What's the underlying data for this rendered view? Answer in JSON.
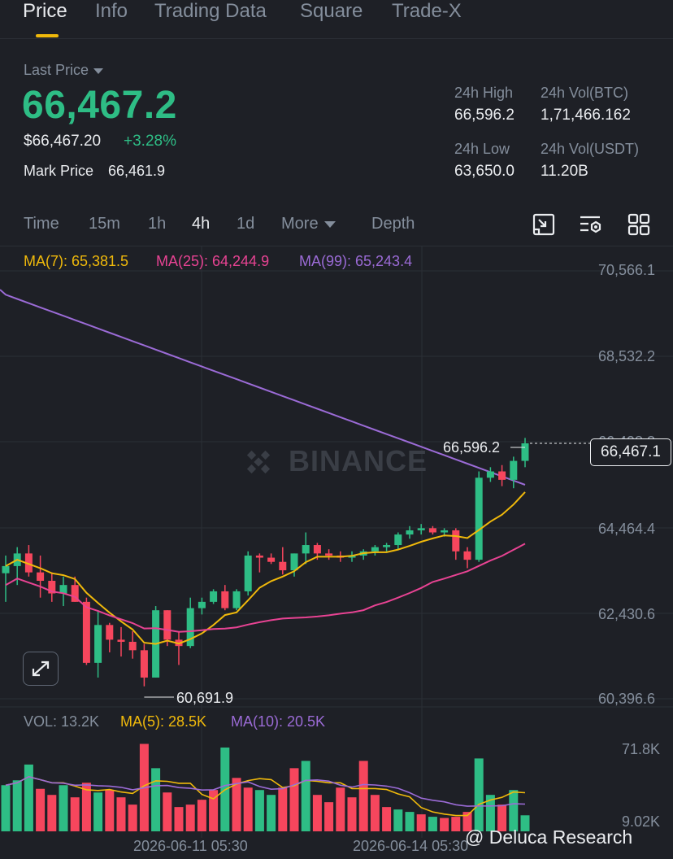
{
  "tabs": [
    {
      "label": "Price",
      "active": true
    },
    {
      "label": "Info",
      "active": false
    },
    {
      "label": "Trading Data",
      "active": false
    },
    {
      "label": "Square",
      "active": false
    },
    {
      "label": "Trade-X",
      "active": false
    }
  ],
  "header": {
    "last_price_label": "Last Price",
    "last_price": "66,467.2",
    "usd_price": "$66,467.20",
    "change_pct": "+3.28%",
    "mark_price_label": "Mark Price",
    "mark_price": "66,461.9"
  },
  "stats": {
    "high_label": "24h High",
    "high_value": "66,596.2",
    "vol_btc_label": "24h Vol(BTC)",
    "vol_btc_value": "1,71,466.162",
    "low_label": "24h Low",
    "low_value": "63,650.0",
    "vol_usdt_label": "24h Vol(USDT)",
    "vol_usdt_value": "11.20B"
  },
  "intervals": {
    "time": "Time",
    "i15m": "15m",
    "i1h": "1h",
    "i4h": "4h",
    "i1d": "1d",
    "more": "More",
    "depth": "Depth",
    "active": "4h"
  },
  "toolbar_icons": [
    "fullscreen-icon",
    "indicator-settings-icon",
    "layout-grid-icon"
  ],
  "ma_legend": {
    "ma7": "MA(7): 65,381.5",
    "ma25": "MA(25): 64,244.9",
    "ma99": "MA(99): 65,243.4"
  },
  "price_axis": [
    "70,566.1",
    "68,532.2",
    "66,498.3",
    "64,464.4",
    "62,430.6",
    "60,396.6"
  ],
  "current_price_tag": "66,467.1",
  "high_marker": "66,596.2",
  "low_marker": "60,691.9",
  "watermark": "BINANCE",
  "volume_legend": {
    "vol": "VOL: 13.2K",
    "ma5": "MA(5): 28.5K",
    "ma10": "MA(10): 20.5K"
  },
  "volume_axis": [
    "71.8K",
    "9.02K"
  ],
  "dates": [
    "2026-06-11 05:30",
    "2026-06-14 05:30"
  ],
  "credit": "@ Deluca Research",
  "colors": {
    "up": "#2ebd85",
    "down": "#f6465d",
    "ma7": "#f0b90b",
    "ma25": "#e84393",
    "ma99": "#9b6bd6",
    "accent": "#f0b90b",
    "background": "#1e2026"
  },
  "chart_data": {
    "type": "candlestick",
    "interval": "4h",
    "ylim": [
      60396.6,
      70566.1
    ],
    "candles": [
      {
        "o": 63380,
        "h": 63800,
        "l": 62700,
        "c": 63550
      },
      {
        "o": 63550,
        "h": 64000,
        "l": 63100,
        "c": 63850
      },
      {
        "o": 63850,
        "h": 64050,
        "l": 63300,
        "c": 63400
      },
      {
        "o": 63400,
        "h": 63800,
        "l": 62800,
        "c": 63200
      },
      {
        "o": 63200,
        "h": 63400,
        "l": 62700,
        "c": 62900
      },
      {
        "o": 62900,
        "h": 63300,
        "l": 62600,
        "c": 63100
      },
      {
        "o": 63100,
        "h": 63300,
        "l": 62700,
        "c": 62700
      },
      {
        "o": 62700,
        "h": 62800,
        "l": 61200,
        "c": 61250
      },
      {
        "o": 61250,
        "h": 62500,
        "l": 60900,
        "c": 62150
      },
      {
        "o": 62150,
        "h": 62200,
        "l": 61500,
        "c": 61800
      },
      {
        "o": 61800,
        "h": 62100,
        "l": 61400,
        "c": 61750
      },
      {
        "o": 61750,
        "h": 62000,
        "l": 61350,
        "c": 61550
      },
      {
        "o": 61550,
        "h": 61700,
        "l": 60692,
        "c": 60900
      },
      {
        "o": 60900,
        "h": 62600,
        "l": 60900,
        "c": 62500
      },
      {
        "o": 62500,
        "h": 62500,
        "l": 61650,
        "c": 61800
      },
      {
        "o": 61800,
        "h": 62000,
        "l": 61200,
        "c": 61650
      },
      {
        "o": 61650,
        "h": 62800,
        "l": 61600,
        "c": 62550
      },
      {
        "o": 62550,
        "h": 62800,
        "l": 62400,
        "c": 62700
      },
      {
        "o": 62700,
        "h": 63000,
        "l": 62650,
        "c": 62950
      },
      {
        "o": 62950,
        "h": 63100,
        "l": 62500,
        "c": 62550
      },
      {
        "o": 62550,
        "h": 63000,
        "l": 62500,
        "c": 62950
      },
      {
        "o": 62950,
        "h": 63900,
        "l": 62850,
        "c": 63800
      },
      {
        "o": 63800,
        "h": 63850,
        "l": 63400,
        "c": 63750
      },
      {
        "o": 63750,
        "h": 63850,
        "l": 63600,
        "c": 63650
      },
      {
        "o": 63650,
        "h": 64000,
        "l": 63350,
        "c": 63450
      },
      {
        "o": 63450,
        "h": 63850,
        "l": 63300,
        "c": 63850
      },
      {
        "o": 63850,
        "h": 64350,
        "l": 63600,
        "c": 64050
      },
      {
        "o": 64050,
        "h": 64100,
        "l": 63700,
        "c": 63850
      },
      {
        "o": 63850,
        "h": 63950,
        "l": 63700,
        "c": 63800
      },
      {
        "o": 63800,
        "h": 63900,
        "l": 63650,
        "c": 63750
      },
      {
        "o": 63750,
        "h": 63900,
        "l": 63650,
        "c": 63800
      },
      {
        "o": 63800,
        "h": 63950,
        "l": 63700,
        "c": 63900
      },
      {
        "o": 63900,
        "h": 64050,
        "l": 63800,
        "c": 64000
      },
      {
        "o": 64000,
        "h": 64100,
        "l": 63900,
        "c": 64050
      },
      {
        "o": 64050,
        "h": 64350,
        "l": 63950,
        "c": 64300
      },
      {
        "o": 64300,
        "h": 64500,
        "l": 64200,
        "c": 64400
      },
      {
        "o": 64400,
        "h": 64550,
        "l": 64300,
        "c": 64450
      },
      {
        "o": 64450,
        "h": 64500,
        "l": 64300,
        "c": 64350
      },
      {
        "o": 64350,
        "h": 64450,
        "l": 64250,
        "c": 64400
      },
      {
        "o": 64400,
        "h": 64450,
        "l": 63700,
        "c": 63900
      },
      {
        "o": 63900,
        "h": 64000,
        "l": 63500,
        "c": 63700
      },
      {
        "o": 63700,
        "h": 65800,
        "l": 63650,
        "c": 65650
      },
      {
        "o": 65650,
        "h": 65900,
        "l": 65550,
        "c": 65800
      },
      {
        "o": 65800,
        "h": 65950,
        "l": 65450,
        "c": 65600
      },
      {
        "o": 65600,
        "h": 66150,
        "l": 65400,
        "c": 66050
      },
      {
        "o": 66050,
        "h": 66596,
        "l": 65900,
        "c": 66467
      }
    ],
    "volumes": [
      {
        "v": 38000,
        "up": true
      },
      {
        "v": 42000,
        "up": true
      },
      {
        "v": 55000,
        "up": true
      },
      {
        "v": 35000,
        "up": false
      },
      {
        "v": 30000,
        "up": false
      },
      {
        "v": 38000,
        "up": true
      },
      {
        "v": 28000,
        "up": false
      },
      {
        "v": 40000,
        "up": false
      },
      {
        "v": 32000,
        "up": true
      },
      {
        "v": 34000,
        "up": false
      },
      {
        "v": 28000,
        "up": false
      },
      {
        "v": 22000,
        "up": false
      },
      {
        "v": 72000,
        "up": false
      },
      {
        "v": 52000,
        "up": true
      },
      {
        "v": 32000,
        "up": false
      },
      {
        "v": 20000,
        "up": false
      },
      {
        "v": 22000,
        "up": false
      },
      {
        "v": 26000,
        "up": false
      },
      {
        "v": 34000,
        "up": false
      },
      {
        "v": 69000,
        "up": true
      },
      {
        "v": 44000,
        "up": false
      },
      {
        "v": 36000,
        "up": false
      },
      {
        "v": 34000,
        "up": true
      },
      {
        "v": 30000,
        "up": true
      },
      {
        "v": 36000,
        "up": false
      },
      {
        "v": 52000,
        "up": false
      },
      {
        "v": 58000,
        "up": true
      },
      {
        "v": 30000,
        "up": false
      },
      {
        "v": 24000,
        "up": false
      },
      {
        "v": 36000,
        "up": false
      },
      {
        "v": 28000,
        "up": false
      },
      {
        "v": 58000,
        "up": false
      },
      {
        "v": 30000,
        "up": false
      },
      {
        "v": 20000,
        "up": false
      },
      {
        "v": 18000,
        "up": true
      },
      {
        "v": 16000,
        "up": true
      },
      {
        "v": 14000,
        "up": false
      },
      {
        "v": 12000,
        "up": true
      },
      {
        "v": 11000,
        "up": false
      },
      {
        "v": 12000,
        "up": false
      },
      {
        "v": 16000,
        "up": false
      },
      {
        "v": 60000,
        "up": true
      },
      {
        "v": 30000,
        "up": true
      },
      {
        "v": 22000,
        "up": false
      },
      {
        "v": 34000,
        "up": true
      },
      {
        "v": 13200,
        "up": true
      }
    ],
    "vol_ylim": [
      0,
      75000
    ]
  }
}
